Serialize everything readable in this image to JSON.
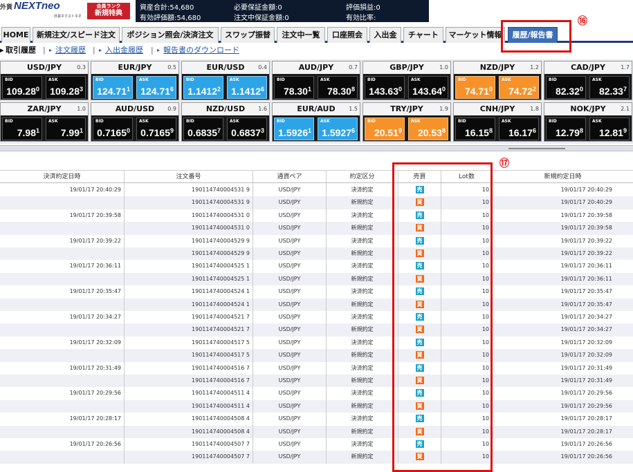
{
  "header": {
    "logo_small": "外貨",
    "logo_main": "NEXTneo",
    "logo_sub": "外貨ネクストネオ",
    "badge_line1": "会員ランク",
    "badge_line2": "新規特典",
    "account": [
      {
        "label": "資産合計:54,680"
      },
      {
        "label": "有効評価額:54,680"
      },
      {
        "label": "必要保証金額:0"
      },
      {
        "label": "注文中保証金額:0"
      },
      {
        "label": "評価損益:0"
      },
      {
        "label": "有効比率:"
      }
    ]
  },
  "nav": {
    "tabs": [
      {
        "label": "HOME"
      },
      {
        "label": "新規注文/スピード注文"
      },
      {
        "label": "ポジション照会/決済注文"
      },
      {
        "label": "スワップ振替"
      },
      {
        "label": "注文中一覧"
      },
      {
        "label": "口座照会"
      },
      {
        "label": "入出金"
      },
      {
        "label": "チャート"
      },
      {
        "label": "マーケット情報"
      },
      {
        "label": "履歴/報告書"
      }
    ]
  },
  "subnav": {
    "current": "取引履歴",
    "links": [
      {
        "label": "注文履歴"
      },
      {
        "label": "入出金履歴"
      },
      {
        "label": "報告書のダウンロード"
      }
    ]
  },
  "rates": [
    {
      "pair": "USD/JPY",
      "spread": "0.3",
      "bid": "109.28",
      "bid_small": "0",
      "ask": "109.28",
      "ask_small": "3",
      "style": "dark"
    },
    {
      "pair": "EUR/JPY",
      "spread": "0.5",
      "bid": "124.71",
      "bid_small": "1",
      "ask": "124.71",
      "ask_small": "6",
      "style": "blue"
    },
    {
      "pair": "EUR/USD",
      "spread": "0.4",
      "bid": "1.1412",
      "bid_small": "2",
      "ask": "1.1412",
      "ask_small": "6",
      "style": "blue"
    },
    {
      "pair": "AUD/JPY",
      "spread": "0.7",
      "bid": "78.30",
      "bid_small": "1",
      "ask": "78.30",
      "ask_small": "8",
      "style": "dark"
    },
    {
      "pair": "GBP/JPY",
      "spread": "1.0",
      "bid": "143.63",
      "bid_small": "0",
      "ask": "143.64",
      "ask_small": "0",
      "style": "dark"
    },
    {
      "pair": "NZD/JPY",
      "spread": "1.2",
      "bid": "74.71",
      "bid_small": "0",
      "ask": "74.72",
      "ask_small": "2",
      "style": "orange"
    },
    {
      "pair": "CAD/JPY",
      "spread": "1.7",
      "bid": "82.32",
      "bid_small": "0",
      "ask": "82.33",
      "ask_small": "7",
      "style": "dark"
    },
    {
      "pair": "ZAR/JPY",
      "spread": "1.0",
      "bid": "7.98",
      "bid_small": "1",
      "ask": "7.99",
      "ask_small": "1",
      "style": "dark"
    },
    {
      "pair": "AUD/USD",
      "spread": "0.9",
      "bid": "0.7165",
      "bid_small": "0",
      "ask": "0.7165",
      "ask_small": "9",
      "style": "dark"
    },
    {
      "pair": "NZD/USD",
      "spread": "1.6",
      "bid": "0.6835",
      "bid_small": "7",
      "ask": "0.6837",
      "ask_small": "3",
      "style": "dark"
    },
    {
      "pair": "EUR/AUD",
      "spread": "1.5",
      "bid": "1.5926",
      "bid_small": "1",
      "ask": "1.5927",
      "ask_small": "6",
      "style": "blue"
    },
    {
      "pair": "TRY/JPY",
      "spread": "1.9",
      "bid": "20.51",
      "bid_small": "9",
      "ask": "20.53",
      "ask_small": "8",
      "style": "orange"
    },
    {
      "pair": "CNH/JPY",
      "spread": "1.8",
      "bid": "16.15",
      "bid_small": "8",
      "ask": "16.17",
      "ask_small": "6",
      "style": "dark"
    },
    {
      "pair": "NOK/JPY",
      "spread": "2.1",
      "bid": "12.79",
      "bid_small": "8",
      "ask": "12.81",
      "ask_small": "9",
      "style": "dark"
    }
  ],
  "quote_labels": {
    "bid": "BID",
    "ask": "ASK"
  },
  "table": {
    "headers": [
      "決済約定日時",
      "注文番号",
      "通貨ペア",
      "約定区分",
      "売買",
      "Lot数",
      "新規約定日時"
    ],
    "rows": [
      {
        "settle": "19/01/17 20:40:29",
        "order": "190114740004531 9",
        "pair": "USD/JPY",
        "kind": "決済約定",
        "side": "売",
        "lot": "10",
        "opened": "19/01/17 20:40:29"
      },
      {
        "settle": "",
        "order": "190114740004531 9",
        "pair": "USD/JPY",
        "kind": "新規約定",
        "side": "買",
        "lot": "10",
        "opened": "19/01/17 20:40:29"
      },
      {
        "settle": "19/01/17 20:39:58",
        "order": "190114740004531 0",
        "pair": "USD/JPY",
        "kind": "決済約定",
        "side": "売",
        "lot": "10",
        "opened": "19/01/17 20:39:58"
      },
      {
        "settle": "",
        "order": "190114740004531 0",
        "pair": "USD/JPY",
        "kind": "新規約定",
        "side": "買",
        "lot": "10",
        "opened": "19/01/17 20:39:58"
      },
      {
        "settle": "19/01/17 20:39:22",
        "order": "190114740004529 9",
        "pair": "USD/JPY",
        "kind": "決済約定",
        "side": "売",
        "lot": "10",
        "opened": "19/01/17 20:39:22"
      },
      {
        "settle": "",
        "order": "190114740004529 9",
        "pair": "USD/JPY",
        "kind": "新規約定",
        "side": "買",
        "lot": "10",
        "opened": "19/01/17 20:39:22"
      },
      {
        "settle": "19/01/17 20:36:11",
        "order": "190114740004525 1",
        "pair": "USD/JPY",
        "kind": "決済約定",
        "side": "売",
        "lot": "10",
        "opened": "19/01/17 20:36:11"
      },
      {
        "settle": "",
        "order": "190114740004525 1",
        "pair": "USD/JPY",
        "kind": "新規約定",
        "side": "買",
        "lot": "10",
        "opened": "19/01/17 20:36:11"
      },
      {
        "settle": "19/01/17 20:35:47",
        "order": "190114740004524 1",
        "pair": "USD/JPY",
        "kind": "決済約定",
        "side": "売",
        "lot": "10",
        "opened": "19/01/17 20:35:47"
      },
      {
        "settle": "",
        "order": "190114740004524 1",
        "pair": "USD/JPY",
        "kind": "新規約定",
        "side": "買",
        "lot": "10",
        "opened": "19/01/17 20:35:47"
      },
      {
        "settle": "19/01/17 20:34:27",
        "order": "190114740004521 7",
        "pair": "USD/JPY",
        "kind": "決済約定",
        "side": "売",
        "lot": "10",
        "opened": "19/01/17 20:34:27"
      },
      {
        "settle": "",
        "order": "190114740004521 7",
        "pair": "USD/JPY",
        "kind": "新規約定",
        "side": "買",
        "lot": "10",
        "opened": "19/01/17 20:34:27"
      },
      {
        "settle": "19/01/17 20:32:09",
        "order": "190114740004517 5",
        "pair": "USD/JPY",
        "kind": "決済約定",
        "side": "売",
        "lot": "10",
        "opened": "19/01/17 20:32:09"
      },
      {
        "settle": "",
        "order": "190114740004517 5",
        "pair": "USD/JPY",
        "kind": "新規約定",
        "side": "買",
        "lot": "10",
        "opened": "19/01/17 20:32:09"
      },
      {
        "settle": "19/01/17 20:31:49",
        "order": "190114740004516 7",
        "pair": "USD/JPY",
        "kind": "決済約定",
        "side": "売",
        "lot": "10",
        "opened": "19/01/17 20:31:49"
      },
      {
        "settle": "",
        "order": "190114740004516 7",
        "pair": "USD/JPY",
        "kind": "新規約定",
        "side": "買",
        "lot": "10",
        "opened": "19/01/17 20:31:49"
      },
      {
        "settle": "19/01/17 20:29:56",
        "order": "190114740004511 4",
        "pair": "USD/JPY",
        "kind": "決済約定",
        "side": "売",
        "lot": "10",
        "opened": "19/01/17 20:29:56"
      },
      {
        "settle": "",
        "order": "190114740004511 4",
        "pair": "USD/JPY",
        "kind": "新規約定",
        "side": "買",
        "lot": "10",
        "opened": "19/01/17 20:29:56"
      },
      {
        "settle": "19/01/17 20:28:17",
        "order": "190114740004508 4",
        "pair": "USD/JPY",
        "kind": "決済約定",
        "side": "売",
        "lot": "10",
        "opened": "19/01/17 20:28:17"
      },
      {
        "settle": "",
        "order": "190114740004508 4",
        "pair": "USD/JPY",
        "kind": "新規約定",
        "side": "買",
        "lot": "10",
        "opened": "19/01/17 20:28:17"
      },
      {
        "settle": "19/01/17 20:26:56",
        "order": "190114740004507 7",
        "pair": "USD/JPY",
        "kind": "決済約定",
        "side": "売",
        "lot": "10",
        "opened": "19/01/17 20:26:56"
      },
      {
        "settle": "",
        "order": "190114740004507 7",
        "pair": "USD/JPY",
        "kind": "新規約定",
        "side": "買",
        "lot": "10",
        "opened": "19/01/17 20:26:56"
      }
    ]
  },
  "annotations": {
    "tab_marker": "⑯",
    "column_marker": "⑰"
  },
  "colors": {
    "annotation_red": "#e01010",
    "sell_badge": "#1aa2c8",
    "buy_badge": "#f06a1a",
    "active_tab": "#3d6fb8"
  }
}
